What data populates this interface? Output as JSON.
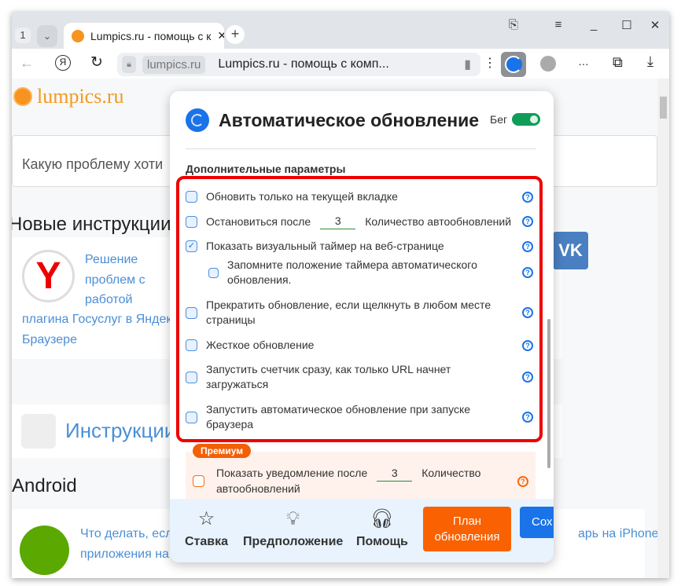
{
  "browser": {
    "tab_count": "1",
    "tab_title": "Lumpics.ru - помощь с к",
    "domain": "lumpics.ru",
    "page_title": "Lumpics.ru - помощь с комп...",
    "icons": [
      "bookmarks-icon",
      "menu-icon",
      "minimize-icon",
      "maximize-icon",
      "close-icon",
      "back-icon",
      "yandex-icon",
      "reload-icon",
      "lock-icon",
      "bookmark-icon",
      "more-icon",
      "auto-refresh-extension-icon",
      "globe-icon",
      "ellipsis-icon",
      "extensions-icon",
      "download-icon"
    ]
  },
  "page": {
    "logo": "lumpics.ru",
    "search_placeholder": "Какую проблему хоти",
    "new_heading": "Новые инструкции:",
    "article1": [
      "Решение",
      "проблем с",
      "работой",
      "плагина Госуслуг в Яндекс",
      "Браузере"
    ],
    "instructions_heading": "Инструкции",
    "android_heading": "Android",
    "article2": [
      "Что делать, если",
      "приложения на"
    ],
    "article3": "арь на iPhone"
  },
  "popup": {
    "title": "Автоматическое обновление",
    "run_label": "Бег",
    "run_enabled": true,
    "section": "Дополнительные параметры",
    "options": [
      {
        "label": "Обновить только на текущей вкладке",
        "checked": false
      },
      {
        "label_before": "Остановиться после",
        "value": "3",
        "label_after": "Количество автообновлений",
        "checked": false
      },
      {
        "label": "Показать визуальный таймер на веб-странице",
        "checked": true
      },
      {
        "label": "Запомните положение таймера автоматического обновления.",
        "checked": false
      },
      {
        "label": "Прекратить обновление, если щелкнуть в любом месте страницы",
        "checked": false
      },
      {
        "label": "Жесткое обновление",
        "checked": false
      },
      {
        "label": "Запустить счетчик сразу, как только URL начнет загружаться",
        "checked": false
      },
      {
        "label": "Запустить автоматическое обновление при запуске браузера",
        "checked": false
      }
    ],
    "premium": {
      "badge": "Премиум",
      "label_before": "Показать уведомление после",
      "value": "3",
      "label_after": "Количество автообновлений",
      "checked": false
    },
    "footer": {
      "rate": "Ставка",
      "suggest": "Предположение",
      "help": "Помощь",
      "plan_line1": "План",
      "plan_line2": "обновления",
      "save": "Сох"
    },
    "colors": {
      "accent": "#1a73e8",
      "premium": "#fa6100",
      "highlight": "#ee0000",
      "toggle": "#0f9d58"
    }
  }
}
